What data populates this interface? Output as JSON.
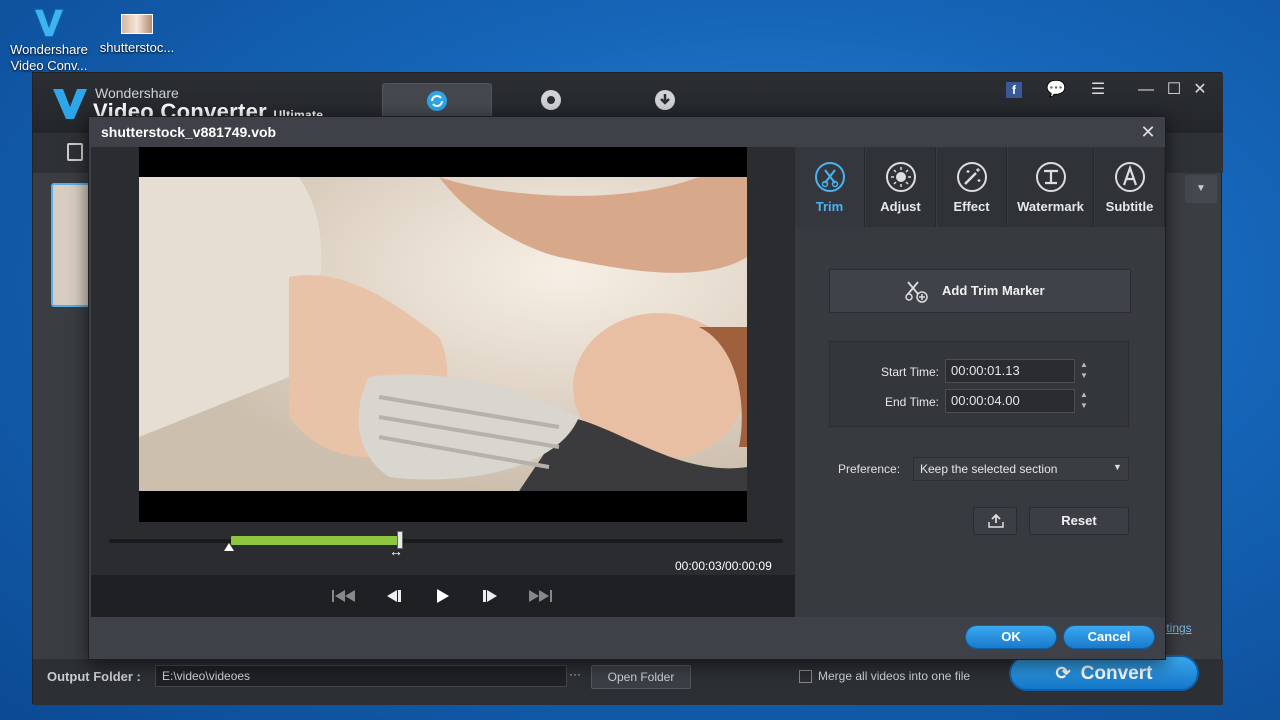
{
  "desktop": {
    "icons": [
      {
        "label": "Wondershare Video Conv...",
        "icon": "wondershare-v-icon"
      },
      {
        "label": "shutterstoc...",
        "icon": "image-file-icon"
      }
    ]
  },
  "app": {
    "brand_small": "Wondershare",
    "brand_big": "Video Converter",
    "brand_edition": "Ultimate",
    "tabs": [
      {
        "icon": "convert-icon",
        "active": true
      },
      {
        "icon": "burn-disc-icon",
        "active": false
      },
      {
        "icon": "download-icon",
        "active": false
      }
    ],
    "window_buttons": [
      "facebook-icon",
      "chat-icon",
      "menu-icon",
      "minimize-icon",
      "maximize-icon",
      "close-icon"
    ],
    "output_folder_label": "Output Folder :",
    "output_folder_value": "E:\\video\\videoes",
    "output_folder_browse": "···",
    "open_folder_label": "Open Folder",
    "merge_label": "Merge all videos into one file",
    "convert_label": "Convert",
    "settings_link": "ttings"
  },
  "dialog": {
    "title": "shutterstock_v881749.vob",
    "time_display": "00:00:03/00:00:09",
    "trim_selection": {
      "start_fraction": 0.19,
      "end_fraction": 0.44,
      "playhead_fraction": 0.44
    },
    "side_tabs": [
      {
        "label": "Trim",
        "icon": "scissors-icon",
        "active": true
      },
      {
        "label": "Adjust",
        "icon": "brightness-icon",
        "active": false
      },
      {
        "label": "Effect",
        "icon": "magic-wand-icon",
        "active": false
      },
      {
        "label": "Watermark",
        "icon": "watermark-icon",
        "active": false
      },
      {
        "label": "Subtitle",
        "icon": "subtitle-icon",
        "active": false
      }
    ],
    "add_trim_marker_label": "Add Trim Marker",
    "start_time_label": "Start Time:",
    "start_time_value": "00:00:01.13",
    "end_time_label": "End Time:",
    "end_time_value": "00:00:04.00",
    "preference_label": "Preference:",
    "preference_value": "Keep the selected section",
    "reset_label": "Reset",
    "ok_label": "OK",
    "cancel_label": "Cancel"
  },
  "colors": {
    "accent": "#4ab3f2",
    "trim_green": "#8ec63f",
    "button_blue": "#1a7acb"
  }
}
